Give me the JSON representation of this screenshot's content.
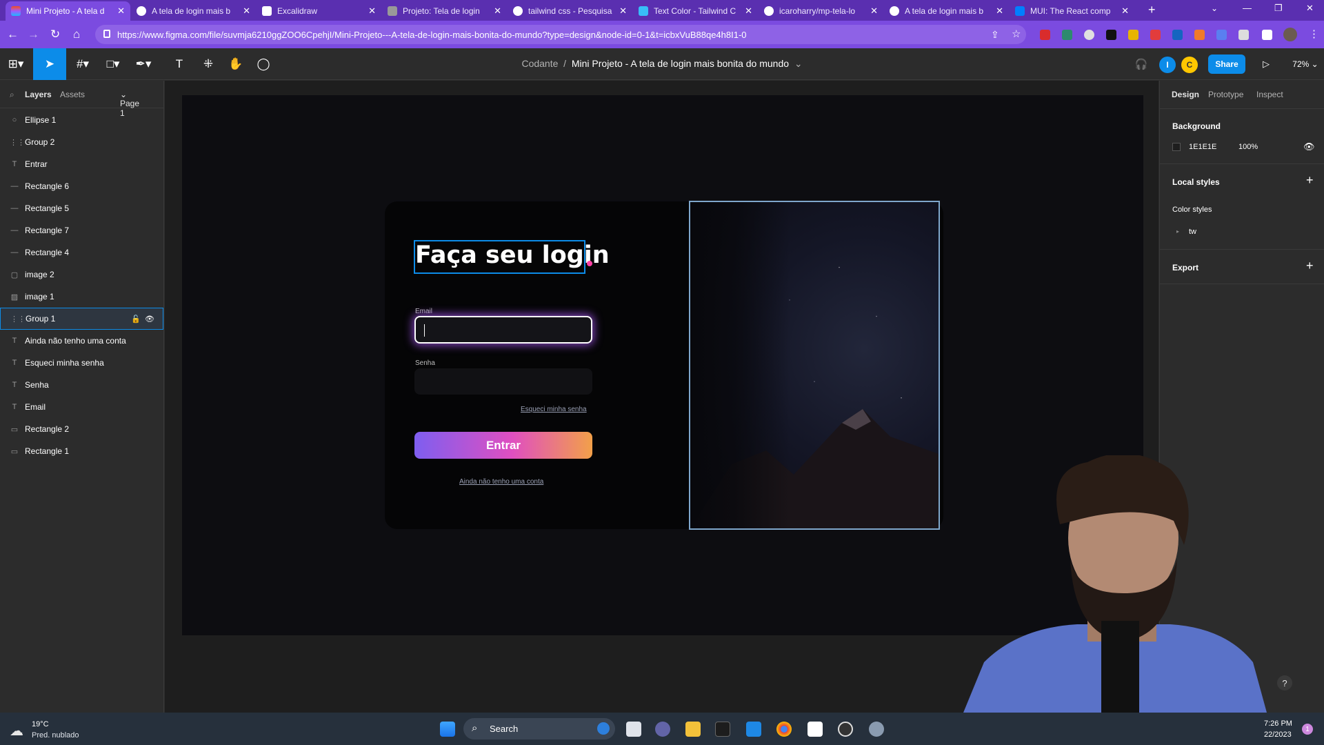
{
  "browser": {
    "tabs": [
      {
        "label": "Mini Projeto - A tela d",
        "active": true
      },
      {
        "label": "A tela de login mais b"
      },
      {
        "label": "Excalidraw"
      },
      {
        "label": "Projeto: Tela de login"
      },
      {
        "label": "tailwind css - Pesquisa"
      },
      {
        "label": "Text Color - Tailwind C"
      },
      {
        "label": "icaroharry/mp-tela-lo"
      },
      {
        "label": "A tela de login mais b"
      },
      {
        "label": "MUI: The React comp"
      }
    ],
    "url": "https://www.figma.com/file/suvmja6210ggZOO6CpehjI/Mini-Projeto---A-tela-de-login-mais-bonita-do-mundo?type=design&node-id=0-1&t=icbxVuB88qe4h8I1-0",
    "window_controls": {
      "minimize": "—",
      "restore": "❐",
      "close": "✕"
    }
  },
  "figma": {
    "breadcrumb": {
      "team": "Codante",
      "separator": "/",
      "file": "Mini Projeto - A tela de login mais bonita do mundo"
    },
    "share_label": "Share",
    "zoom": "72%",
    "avatars": [
      "I",
      "C"
    ]
  },
  "left_panel": {
    "tabs": {
      "layers": "Layers",
      "assets": "Assets",
      "page": "Page 1"
    },
    "layers": [
      {
        "icon": "○",
        "name": "Ellipse 1"
      },
      {
        "icon": "⋮⋮",
        "name": "Group 2"
      },
      {
        "icon": "T",
        "name": "Entrar"
      },
      {
        "icon": "—",
        "name": "Rectangle 6"
      },
      {
        "icon": "—",
        "name": "Rectangle 5"
      },
      {
        "icon": "—",
        "name": "Rectangle 7"
      },
      {
        "icon": "—",
        "name": "Rectangle 4"
      },
      {
        "icon": "▢",
        "name": "image 2"
      },
      {
        "icon": "▨",
        "name": "image 1"
      },
      {
        "icon": "⋮⋮",
        "name": "Group 1",
        "selected": true
      },
      {
        "icon": "T",
        "name": "Ainda não tenho uma conta"
      },
      {
        "icon": "T",
        "name": "Esqueci minha senha"
      },
      {
        "icon": "T",
        "name": "Senha"
      },
      {
        "icon": "T",
        "name": "Email"
      },
      {
        "icon": "▭",
        "name": "Rectangle 2"
      },
      {
        "icon": "▭",
        "name": "Rectangle 1"
      }
    ]
  },
  "canvas": {
    "login": {
      "title": "Faça seu login",
      "email_label": "Email",
      "password_label": "Senha",
      "forgot": "Esqueci minha senha",
      "button": "Entrar",
      "no_account": "Ainda não tenho uma conta"
    }
  },
  "right_panel": {
    "tabs": {
      "design": "Design",
      "prototype": "Prototype",
      "inspect": "Inspect"
    },
    "background_heading": "Background",
    "background_hex": "1E1E1E",
    "background_opacity": "100%",
    "local_styles": "Local styles",
    "color_styles": "Color styles",
    "tw": "tw",
    "export": "Export",
    "help": "?"
  },
  "taskbar": {
    "weather_temp": "19°C",
    "weather_desc": "Pred. nublado",
    "search": "Search",
    "time": "7:26 PM",
    "date": "22/2023",
    "badge": "1"
  },
  "colors": {
    "accent": "#0c8ce9",
    "chrome": "#7b4be0",
    "canvas": "#1e1e1e",
    "background": "#1E1E1E"
  }
}
